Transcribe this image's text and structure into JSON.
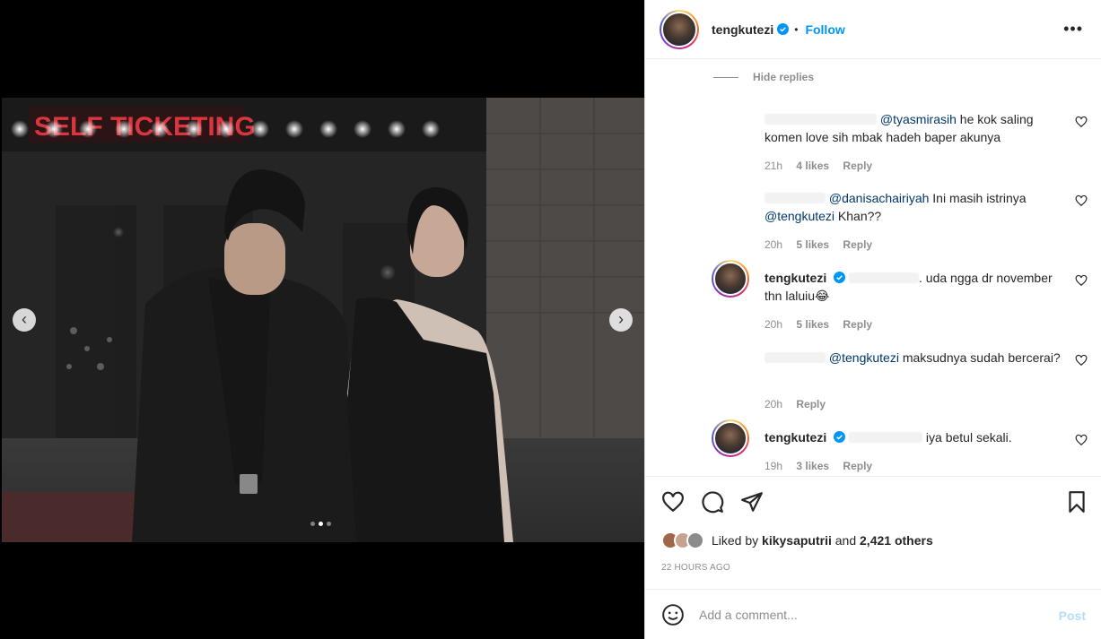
{
  "post": {
    "username": "tengkutezi",
    "follow_label": "Follow",
    "separator": "•",
    "more_label": "•••"
  },
  "photo": {
    "sign_text": "SELF TICKETING",
    "carousel_count": 3,
    "carousel_active_index": 1
  },
  "comments": {
    "hide_replies_label": "Hide replies",
    "items": [
      {
        "mention": "@tyasmirasih",
        "text": " he kok saling komen love sih mbak hadeh baper akunya",
        "time": "21h",
        "likes": "4 likes",
        "reply_label": "Reply"
      },
      {
        "mention": "@danisachairiyah",
        "text": " Ini masih istrinya ",
        "mention2": "@tengkutezi",
        "text2": " Khan??",
        "time": "20h",
        "likes": "5 likes",
        "reply_label": "Reply"
      },
      {
        "username": "tengkutezi",
        "text": ". uda ngga dr november thn laluiu😂",
        "time": "20h",
        "likes": "5 likes",
        "reply_label": "Reply"
      },
      {
        "mention": "@tengkutezi",
        "text": " maksudnya sudah bercerai?",
        "time": "20h",
        "reply_label": "Reply"
      },
      {
        "username": "tengkutezi",
        "text": "iya betul sekali.",
        "time": "19h",
        "likes": "3 likes",
        "reply_label": "Reply"
      }
    ]
  },
  "actions": {
    "liked_prefix": "Liked by ",
    "liked_user": "kikysaputrii",
    "liked_and": " and ",
    "liked_count": "2,421 others",
    "timestamp": "22 HOURS AGO"
  },
  "add_comment": {
    "placeholder": "Add a comment...",
    "post_label": "Post"
  },
  "colors": {
    "accent": "#0095f6",
    "mention": "#00376b",
    "muted": "#8e8e8e"
  }
}
